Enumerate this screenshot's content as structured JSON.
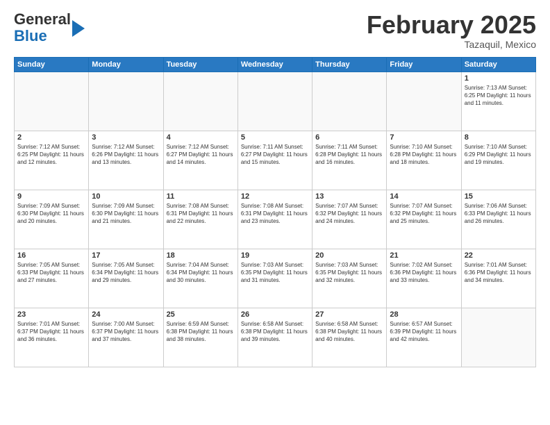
{
  "header": {
    "logo_general": "General",
    "logo_blue": "Blue",
    "month_title": "February 2025",
    "subtitle": "Tazaquil, Mexico"
  },
  "weekdays": [
    "Sunday",
    "Monday",
    "Tuesday",
    "Wednesday",
    "Thursday",
    "Friday",
    "Saturday"
  ],
  "weeks": [
    [
      {
        "day": "",
        "info": ""
      },
      {
        "day": "",
        "info": ""
      },
      {
        "day": "",
        "info": ""
      },
      {
        "day": "",
        "info": ""
      },
      {
        "day": "",
        "info": ""
      },
      {
        "day": "",
        "info": ""
      },
      {
        "day": "1",
        "info": "Sunrise: 7:13 AM\nSunset: 6:25 PM\nDaylight: 11 hours\nand 11 minutes."
      }
    ],
    [
      {
        "day": "2",
        "info": "Sunrise: 7:12 AM\nSunset: 6:25 PM\nDaylight: 11 hours\nand 12 minutes."
      },
      {
        "day": "3",
        "info": "Sunrise: 7:12 AM\nSunset: 6:26 PM\nDaylight: 11 hours\nand 13 minutes."
      },
      {
        "day": "4",
        "info": "Sunrise: 7:12 AM\nSunset: 6:27 PM\nDaylight: 11 hours\nand 14 minutes."
      },
      {
        "day": "5",
        "info": "Sunrise: 7:11 AM\nSunset: 6:27 PM\nDaylight: 11 hours\nand 15 minutes."
      },
      {
        "day": "6",
        "info": "Sunrise: 7:11 AM\nSunset: 6:28 PM\nDaylight: 11 hours\nand 16 minutes."
      },
      {
        "day": "7",
        "info": "Sunrise: 7:10 AM\nSunset: 6:28 PM\nDaylight: 11 hours\nand 18 minutes."
      },
      {
        "day": "8",
        "info": "Sunrise: 7:10 AM\nSunset: 6:29 PM\nDaylight: 11 hours\nand 19 minutes."
      }
    ],
    [
      {
        "day": "9",
        "info": "Sunrise: 7:09 AM\nSunset: 6:30 PM\nDaylight: 11 hours\nand 20 minutes."
      },
      {
        "day": "10",
        "info": "Sunrise: 7:09 AM\nSunset: 6:30 PM\nDaylight: 11 hours\nand 21 minutes."
      },
      {
        "day": "11",
        "info": "Sunrise: 7:08 AM\nSunset: 6:31 PM\nDaylight: 11 hours\nand 22 minutes."
      },
      {
        "day": "12",
        "info": "Sunrise: 7:08 AM\nSunset: 6:31 PM\nDaylight: 11 hours\nand 23 minutes."
      },
      {
        "day": "13",
        "info": "Sunrise: 7:07 AM\nSunset: 6:32 PM\nDaylight: 11 hours\nand 24 minutes."
      },
      {
        "day": "14",
        "info": "Sunrise: 7:07 AM\nSunset: 6:32 PM\nDaylight: 11 hours\nand 25 minutes."
      },
      {
        "day": "15",
        "info": "Sunrise: 7:06 AM\nSunset: 6:33 PM\nDaylight: 11 hours\nand 26 minutes."
      }
    ],
    [
      {
        "day": "16",
        "info": "Sunrise: 7:05 AM\nSunset: 6:33 PM\nDaylight: 11 hours\nand 27 minutes."
      },
      {
        "day": "17",
        "info": "Sunrise: 7:05 AM\nSunset: 6:34 PM\nDaylight: 11 hours\nand 29 minutes."
      },
      {
        "day": "18",
        "info": "Sunrise: 7:04 AM\nSunset: 6:34 PM\nDaylight: 11 hours\nand 30 minutes."
      },
      {
        "day": "19",
        "info": "Sunrise: 7:03 AM\nSunset: 6:35 PM\nDaylight: 11 hours\nand 31 minutes."
      },
      {
        "day": "20",
        "info": "Sunrise: 7:03 AM\nSunset: 6:35 PM\nDaylight: 11 hours\nand 32 minutes."
      },
      {
        "day": "21",
        "info": "Sunrise: 7:02 AM\nSunset: 6:36 PM\nDaylight: 11 hours\nand 33 minutes."
      },
      {
        "day": "22",
        "info": "Sunrise: 7:01 AM\nSunset: 6:36 PM\nDaylight: 11 hours\nand 34 minutes."
      }
    ],
    [
      {
        "day": "23",
        "info": "Sunrise: 7:01 AM\nSunset: 6:37 PM\nDaylight: 11 hours\nand 36 minutes."
      },
      {
        "day": "24",
        "info": "Sunrise: 7:00 AM\nSunset: 6:37 PM\nDaylight: 11 hours\nand 37 minutes."
      },
      {
        "day": "25",
        "info": "Sunrise: 6:59 AM\nSunset: 6:38 PM\nDaylight: 11 hours\nand 38 minutes."
      },
      {
        "day": "26",
        "info": "Sunrise: 6:58 AM\nSunset: 6:38 PM\nDaylight: 11 hours\nand 39 minutes."
      },
      {
        "day": "27",
        "info": "Sunrise: 6:58 AM\nSunset: 6:38 PM\nDaylight: 11 hours\nand 40 minutes."
      },
      {
        "day": "28",
        "info": "Sunrise: 6:57 AM\nSunset: 6:39 PM\nDaylight: 11 hours\nand 42 minutes."
      },
      {
        "day": "",
        "info": ""
      }
    ]
  ]
}
